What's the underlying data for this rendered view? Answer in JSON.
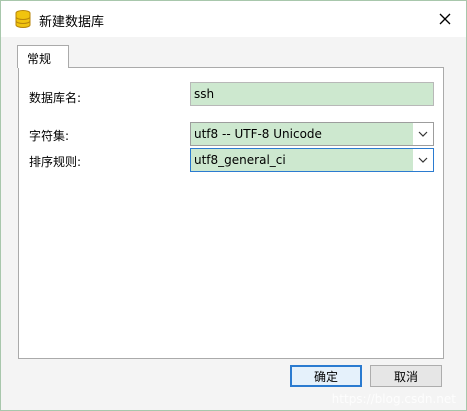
{
  "window": {
    "title": "新建数据库",
    "icons": {
      "app": "database-icon",
      "close": "close-icon"
    }
  },
  "tabs": [
    {
      "label": "常规"
    }
  ],
  "form": {
    "db_name": {
      "label": "数据库名:",
      "value": "ssh"
    },
    "charset": {
      "label": "字符集:",
      "value": "utf8 -- UTF-8 Unicode"
    },
    "collation": {
      "label": "排序规则:",
      "value": "utf8_general_ci"
    }
  },
  "buttons": {
    "ok": "确定",
    "cancel": "取消"
  },
  "watermark": "https://blog.csdn.net",
  "colors": {
    "field_fill": "#cde8cf",
    "focus_border": "#2b7bd0",
    "backdrop": "#c9e6cc"
  }
}
